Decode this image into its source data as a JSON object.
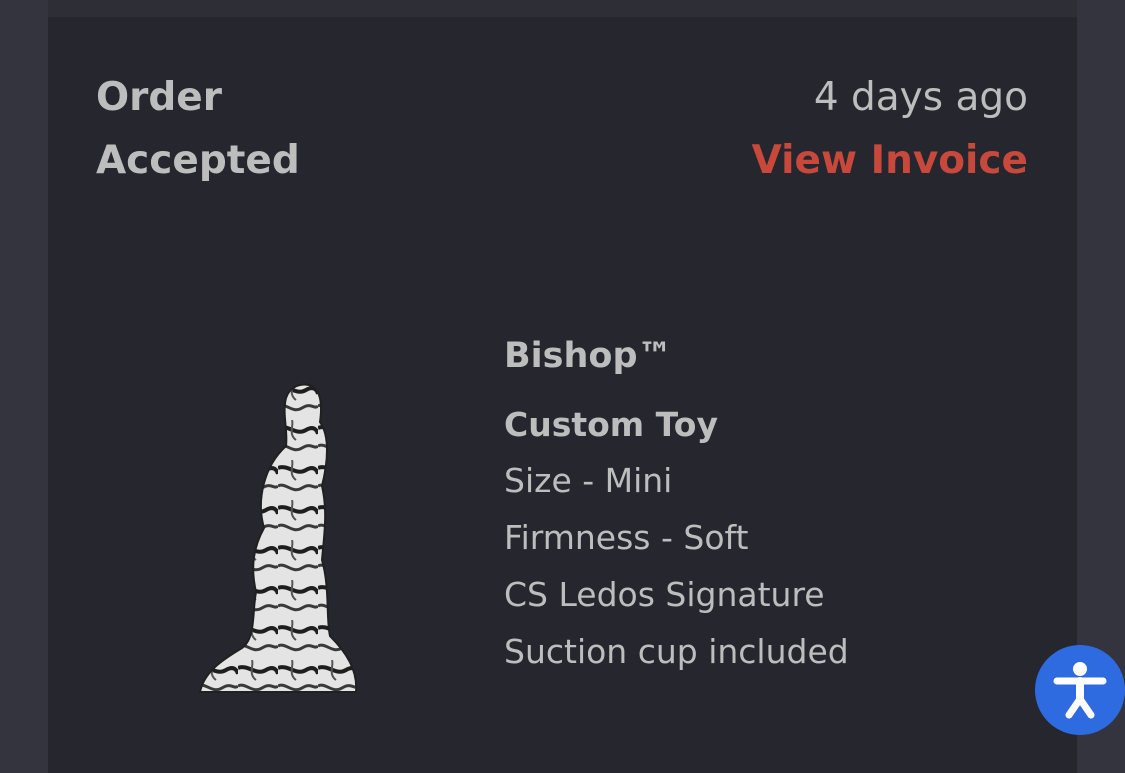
{
  "order": {
    "status_line1": "Order",
    "status_line2": "Accepted",
    "timestamp": "4 days ago",
    "invoice_link": "View Invoice",
    "accent_color": "#c9483c"
  },
  "product": {
    "name": "Bishop™",
    "type": "Custom Toy",
    "options": [
      "Size - Mini",
      "Firmness - Soft",
      "CS Ledos Signature",
      "Suction cup included"
    ]
  },
  "accessibility_button": {
    "icon": "accessibility-icon",
    "color": "#2f6be0"
  }
}
